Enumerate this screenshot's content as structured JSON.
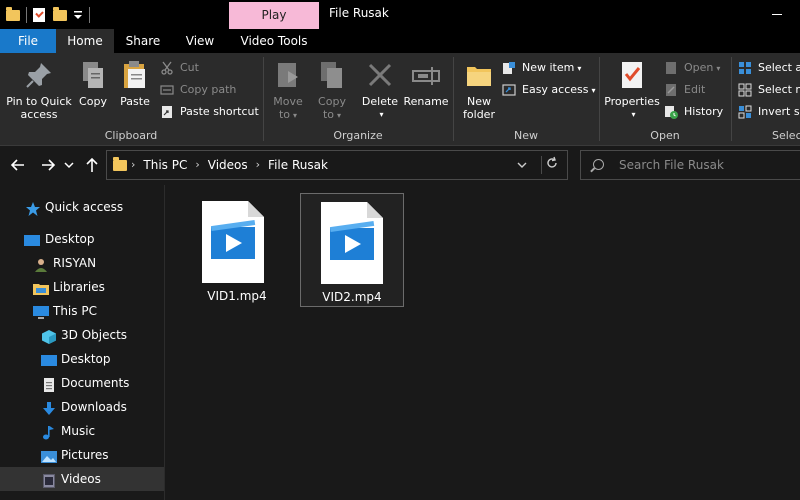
{
  "titlebar": {
    "context_tab": "Play",
    "title": "File Rusak"
  },
  "tabs": {
    "file": "File",
    "home": "Home",
    "share": "Share",
    "view": "View",
    "video_tools": "Video Tools"
  },
  "ribbon": {
    "clipboard": {
      "label": "Clipboard",
      "pin_to_quick_access_line1": "Pin to Quick",
      "pin_to_quick_access_line2": "access",
      "copy": "Copy",
      "paste": "Paste",
      "cut": "Cut",
      "copy_path": "Copy path",
      "paste_shortcut": "Paste shortcut"
    },
    "organize": {
      "label": "Organize",
      "move_to_line1": "Move",
      "move_to_line2": "to",
      "copy_to_line1": "Copy",
      "copy_to_line2": "to",
      "delete": "Delete",
      "rename": "Rename"
    },
    "new": {
      "label": "New",
      "new_folder_line1": "New",
      "new_folder_line2": "folder",
      "new_item": "New item",
      "easy_access": "Easy access"
    },
    "open": {
      "label": "Open",
      "properties": "Properties",
      "open": "Open",
      "edit": "Edit",
      "history": "History"
    },
    "select": {
      "label": "Selec",
      "select_all": "Select al",
      "select_none": "Select n",
      "invert_selection": "Invert se"
    }
  },
  "navbar": {
    "breadcrumb": [
      "This PC",
      "Videos",
      "File Rusak"
    ],
    "search_placeholder": "Search File Rusak"
  },
  "sidebar": {
    "items": [
      {
        "label": "Quick access",
        "icon": "star-icon"
      },
      {
        "label": "Desktop",
        "icon": "desktop-icon"
      },
      {
        "label": "RISYAN",
        "icon": "user-icon"
      },
      {
        "label": "Libraries",
        "icon": "libraries-icon"
      },
      {
        "label": "This PC",
        "icon": "computer-icon"
      },
      {
        "label": "3D Objects",
        "icon": "cube-icon"
      },
      {
        "label": "Desktop",
        "icon": "desktop-icon"
      },
      {
        "label": "Documents",
        "icon": "documents-icon"
      },
      {
        "label": "Downloads",
        "icon": "download-icon"
      },
      {
        "label": "Music",
        "icon": "music-icon"
      },
      {
        "label": "Pictures",
        "icon": "pictures-icon"
      },
      {
        "label": "Videos",
        "icon": "videos-icon"
      }
    ],
    "selected": "Videos"
  },
  "files": [
    {
      "name": "VID1.mp4",
      "icon": "video-file-icon",
      "selected": false
    },
    {
      "name": "VID2.mp4",
      "icon": "video-file-icon",
      "selected": true
    }
  ],
  "colors": {
    "accent": "#1979ca",
    "context_tab": "#f7b9d7",
    "folder": "#f2c55c",
    "background": "#191919",
    "ribbon": "#2b2b2b"
  }
}
